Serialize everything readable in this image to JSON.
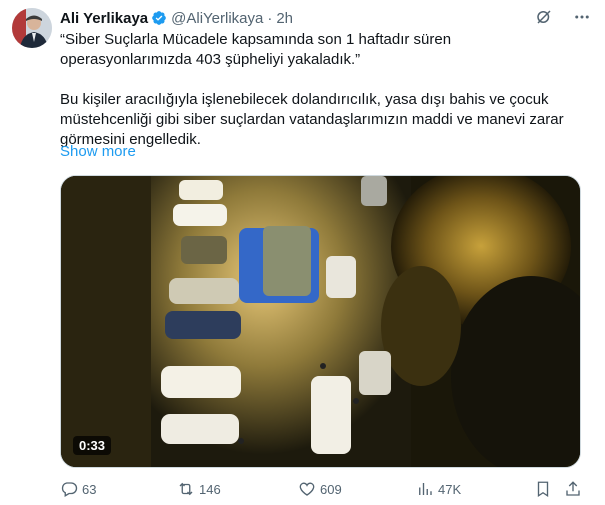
{
  "tweet": {
    "author_name": "Ali Yerlikaya",
    "handle": "@AliYerlikaya",
    "separator": "·",
    "time": "2h",
    "text_line1": "“Siber Suçlarla Mücadele kapsamında son 1 haftadır süren operasyonlarımızda 403 şüpheliyi yakaladık.”",
    "text_line2": "Bu kişiler aracılığıyla işlenebilecek dolandırıcılık, yasa dışı bahis ve çocuk müstehcenliği gibi siber suçlardan vatandaşlarımızın maddi ve manevi zarar görmesini engelledik.",
    "show_more": "Show more",
    "video_duration": "0:33"
  },
  "actions": {
    "replies": "63",
    "reposts": "146",
    "likes": "609",
    "views": "47K"
  },
  "colors": {
    "link": "#1d9bf0",
    "verified": "#1d9bf0",
    "secondary_text": "#536471"
  },
  "icons": {
    "verified": "verified-badge-icon",
    "grok": "grok-icon",
    "more": "more-icon",
    "reply": "reply-icon",
    "repost": "repost-icon",
    "like": "like-icon",
    "views": "views-icon",
    "bookmark": "bookmark-icon",
    "share": "share-icon"
  }
}
